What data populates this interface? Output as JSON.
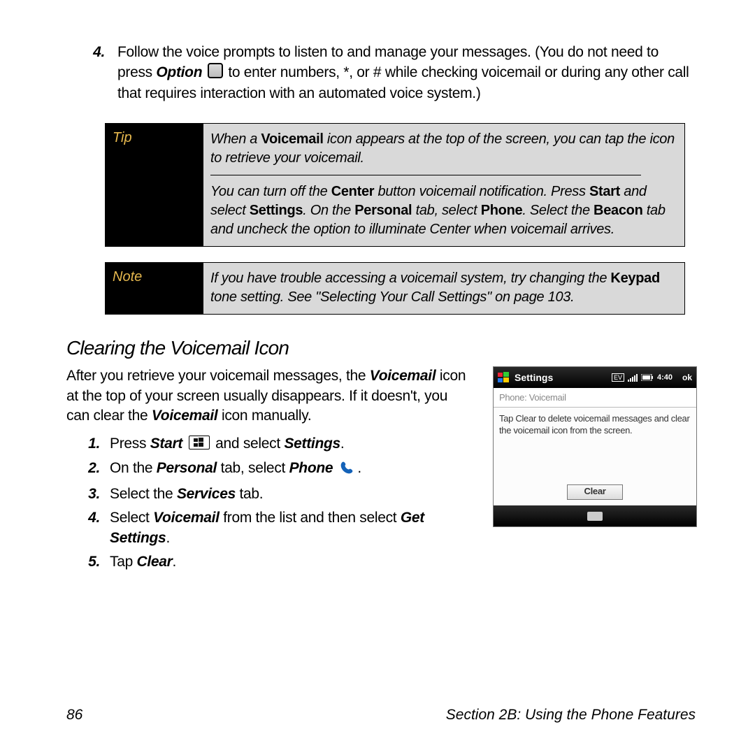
{
  "step4": {
    "num": "4.",
    "t1": "Follow the voice prompts to listen to and manage your messages. (You do not need to press ",
    "opt": "Option",
    "t2": " to enter numbers, *, or # while checking voicemail or during any other call that requires interaction with an automated voice system.)"
  },
  "tip": {
    "label": "Tip",
    "p1a": "When a ",
    "p1b": "Voicemail",
    "p1c": " icon appears at the top of the screen, you can tap the icon to retrieve your voicemail.",
    "p2a": "You can turn off the ",
    "p2b": "Center",
    "p2c": " button voicemail notification. Press ",
    "p2d": "Start",
    "p2e": " and select ",
    "p2f": "Settings",
    "p2g": ". On the ",
    "p2h": "Personal",
    "p2i": " tab, select ",
    "p2j": "Phone",
    "p2k": ". Select the ",
    "p2l": "Beacon",
    "p2m": " tab and uncheck the option to illuminate Center when voicemail arrives."
  },
  "note": {
    "label": "Note",
    "a": "If you have trouble accessing a voicemail system, try changing the ",
    "b": "Keypad",
    "c": " tone setting. See \"Selecting Your Call Settings\" on page 103."
  },
  "heading": "Clearing the Voicemail Icon",
  "intro": {
    "a": "After you retrieve your voicemail messages, the ",
    "b": "Voicemail",
    "c": " icon at the top of your screen usually disappears. If it doesn't, you can clear the ",
    "d": "Voicemail",
    "e": " icon manually."
  },
  "steps": [
    {
      "n": "1.",
      "pre": "Press ",
      "b1": "Start",
      "mid": " ",
      "post": " and select ",
      "b2": "Settings",
      "end": "."
    },
    {
      "n": "2.",
      "pre": "On the ",
      "b1": "Personal",
      "mid": " tab, select ",
      "b2": "Phone",
      "end": " "
    },
    {
      "n": "3.",
      "pre": "Select the ",
      "b1": "Services",
      "mid": " tab.",
      "b2": "",
      "end": ""
    },
    {
      "n": "4.",
      "pre": "Select ",
      "b1": "Voicemail",
      "mid": " from the list and then select ",
      "b2": "Get Settings",
      "end": "."
    },
    {
      "n": "5.",
      "pre": "Tap ",
      "b1": "Clear",
      "mid": ".",
      "b2": "",
      "end": ""
    }
  ],
  "device": {
    "title": "Settings",
    "time": "4:40",
    "ok": "ok",
    "breadcrumb": "Phone: Voicemail",
    "body": "Tap Clear to delete voicemail messages and clear the voicemail icon from the screen.",
    "clear": "Clear"
  },
  "footer": {
    "page": "86",
    "section": "Section 2B: Using the Phone Features"
  }
}
